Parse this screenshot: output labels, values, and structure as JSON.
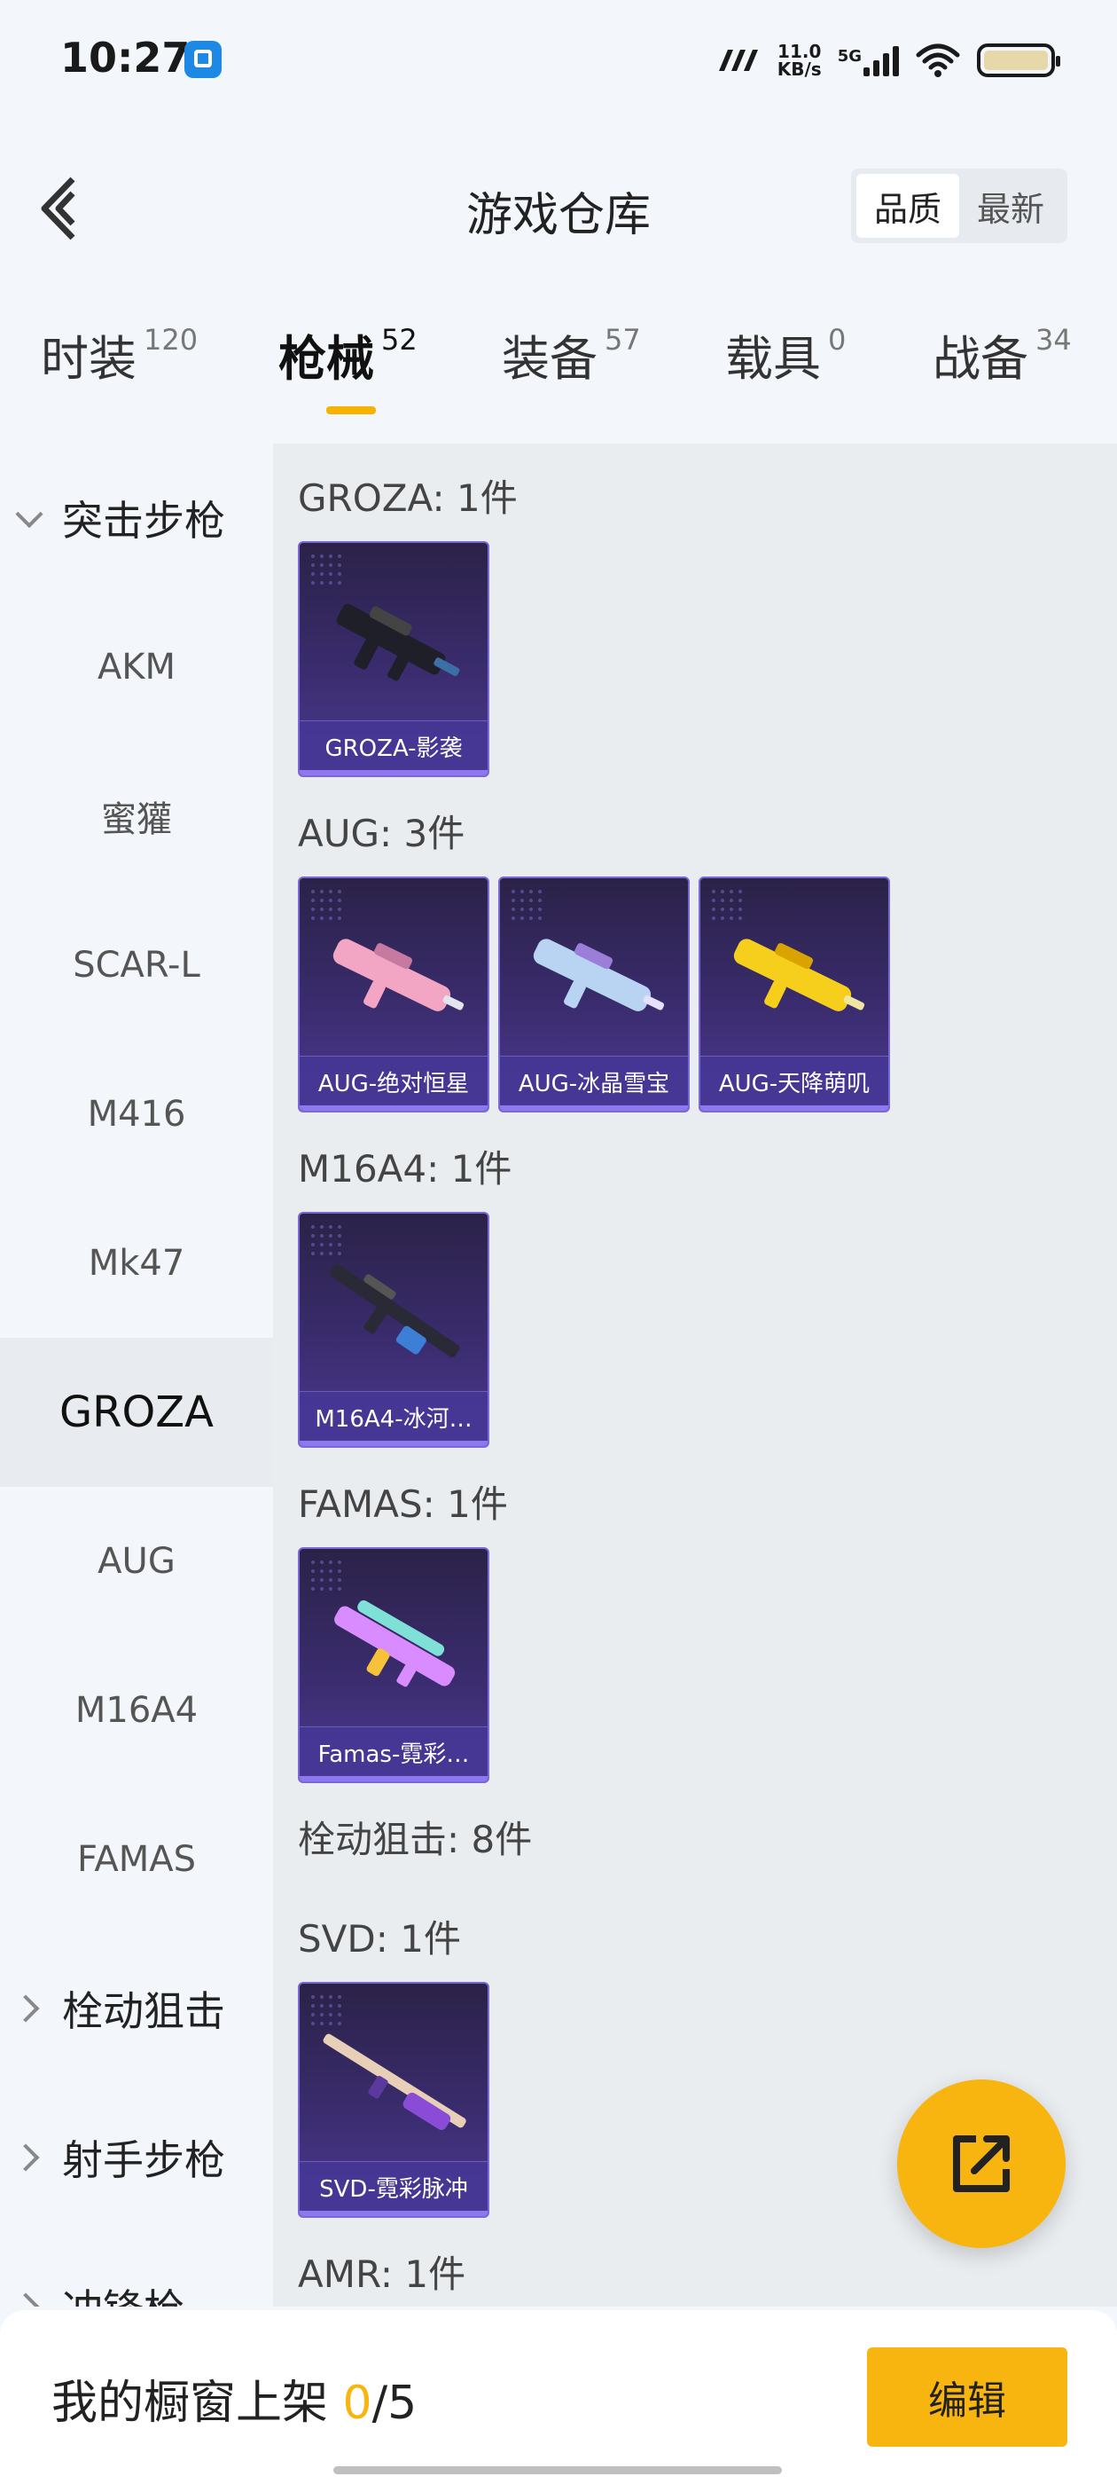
{
  "status_bar": {
    "time": "10:27",
    "speed_value": "11.0",
    "speed_unit": "KB/s",
    "network": "5G",
    "icons": [
      "screenshot-app-icon",
      "signal-icon",
      "wifi-icon",
      "battery-icon"
    ]
  },
  "header": {
    "title": "游戏仓库",
    "back_icon": "back-arrow-icon",
    "sort_options": [
      "品质",
      "最新"
    ],
    "sort_selected": "品质"
  },
  "tabs": [
    {
      "label": "时装",
      "count": "120"
    },
    {
      "label": "枪械",
      "count": "52"
    },
    {
      "label": "装备",
      "count": "57"
    },
    {
      "label": "载具",
      "count": "0"
    },
    {
      "label": "战备",
      "count": "34"
    }
  ],
  "active_tab": "枪械",
  "sidebar": {
    "items": [
      {
        "label": "突击步枪",
        "type": "group-expanded"
      },
      {
        "label": "AKM"
      },
      {
        "label": "蜜獾"
      },
      {
        "label": "SCAR-L"
      },
      {
        "label": "M416"
      },
      {
        "label": "Mk47"
      },
      {
        "label": "GROZA"
      },
      {
        "label": "AUG"
      },
      {
        "label": "M16A4"
      },
      {
        "label": "FAMAS"
      },
      {
        "label": "栓动狙击",
        "type": "group-collapsed"
      },
      {
        "label": "射手步枪",
        "type": "group-collapsed"
      },
      {
        "label": "冲锋枪",
        "type": "group-collapsed"
      }
    ],
    "active": "GROZA"
  },
  "sections": [
    {
      "title": "GROZA: 1件",
      "items": [
        "GROZA-影袭"
      ]
    },
    {
      "title": "AUG: 3件",
      "items": [
        "AUG-绝对恒星",
        "AUG-冰晶雪宝",
        "AUG-天降萌叽"
      ]
    },
    {
      "title": "M16A4: 1件",
      "items": [
        "M16A4-冰河…"
      ]
    },
    {
      "title": "FAMAS: 1件",
      "items": [
        "Famas-霓彩…"
      ]
    },
    {
      "title": "栓动狙击: 8件",
      "items": []
    },
    {
      "title": "SVD: 1件",
      "items": [
        "SVD-霓彩脉冲"
      ]
    },
    {
      "title": "AMR: 1件",
      "items": []
    }
  ],
  "colors": {
    "accent": "#f8b40f",
    "card_bg": "#3a2c6e",
    "skin_groza": "#1f1f2a",
    "skin_aug_1": "#f2a6c4",
    "skin_aug_2": "#b8d4f2",
    "skin_aug_3": "#f5cf1c",
    "skin_m16": "#2a2a36",
    "skin_famas": "#d98cff",
    "skin_svd": "#e8d0b8"
  },
  "fab": {
    "icon": "share-export-icon"
  },
  "bottom_bar": {
    "text": "我的橱窗上架",
    "count": "0",
    "total": "/5",
    "edit_label": "编辑"
  }
}
